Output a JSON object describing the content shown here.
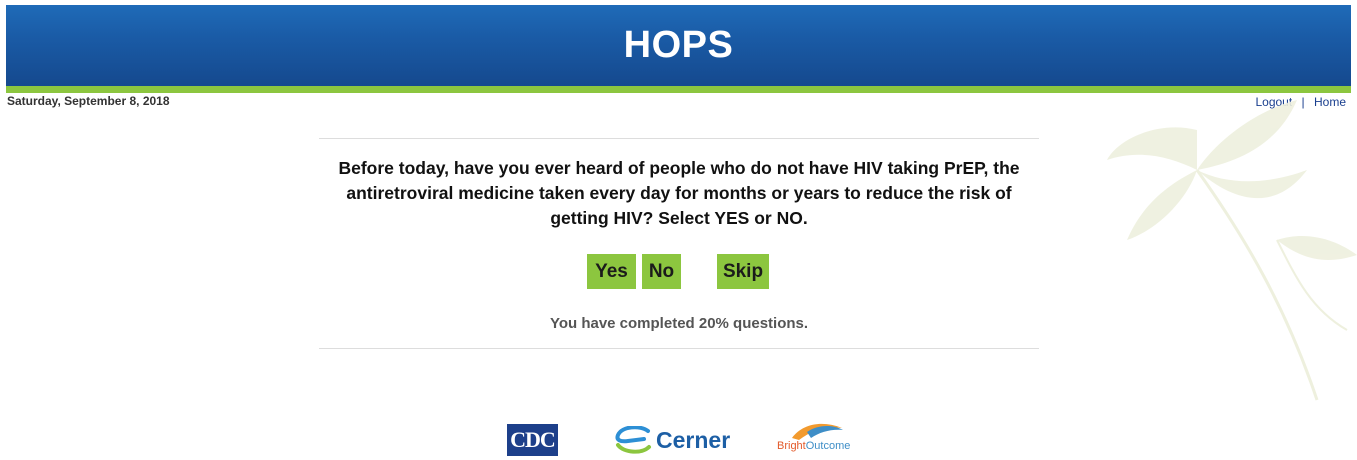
{
  "header": {
    "title": "HOPS"
  },
  "topbar": {
    "date": "Saturday, September 8, 2018",
    "logout_label": "Logout",
    "separator": "|",
    "home_label": "Home"
  },
  "question": {
    "text": "Before today, have you ever heard of people who do not have HIV taking PrEP, the antiretroviral medicine taken every day for months or years to reduce the risk of getting HIV? Select YES or NO."
  },
  "answers": {
    "yes_label": "Yes",
    "no_label": "No",
    "skip_label": "Skip"
  },
  "progress": {
    "text": "You have completed 20% questions.",
    "percent": 20
  },
  "footer": {
    "logos": {
      "cdc": "CDC",
      "cerner": "Cerner",
      "bright_part1": "Bright",
      "bright_part2": "Outcome"
    }
  },
  "colors": {
    "header_blue": "#1a5ba6",
    "accent_green": "#8cc63f",
    "link_blue": "#1a3f8f"
  }
}
